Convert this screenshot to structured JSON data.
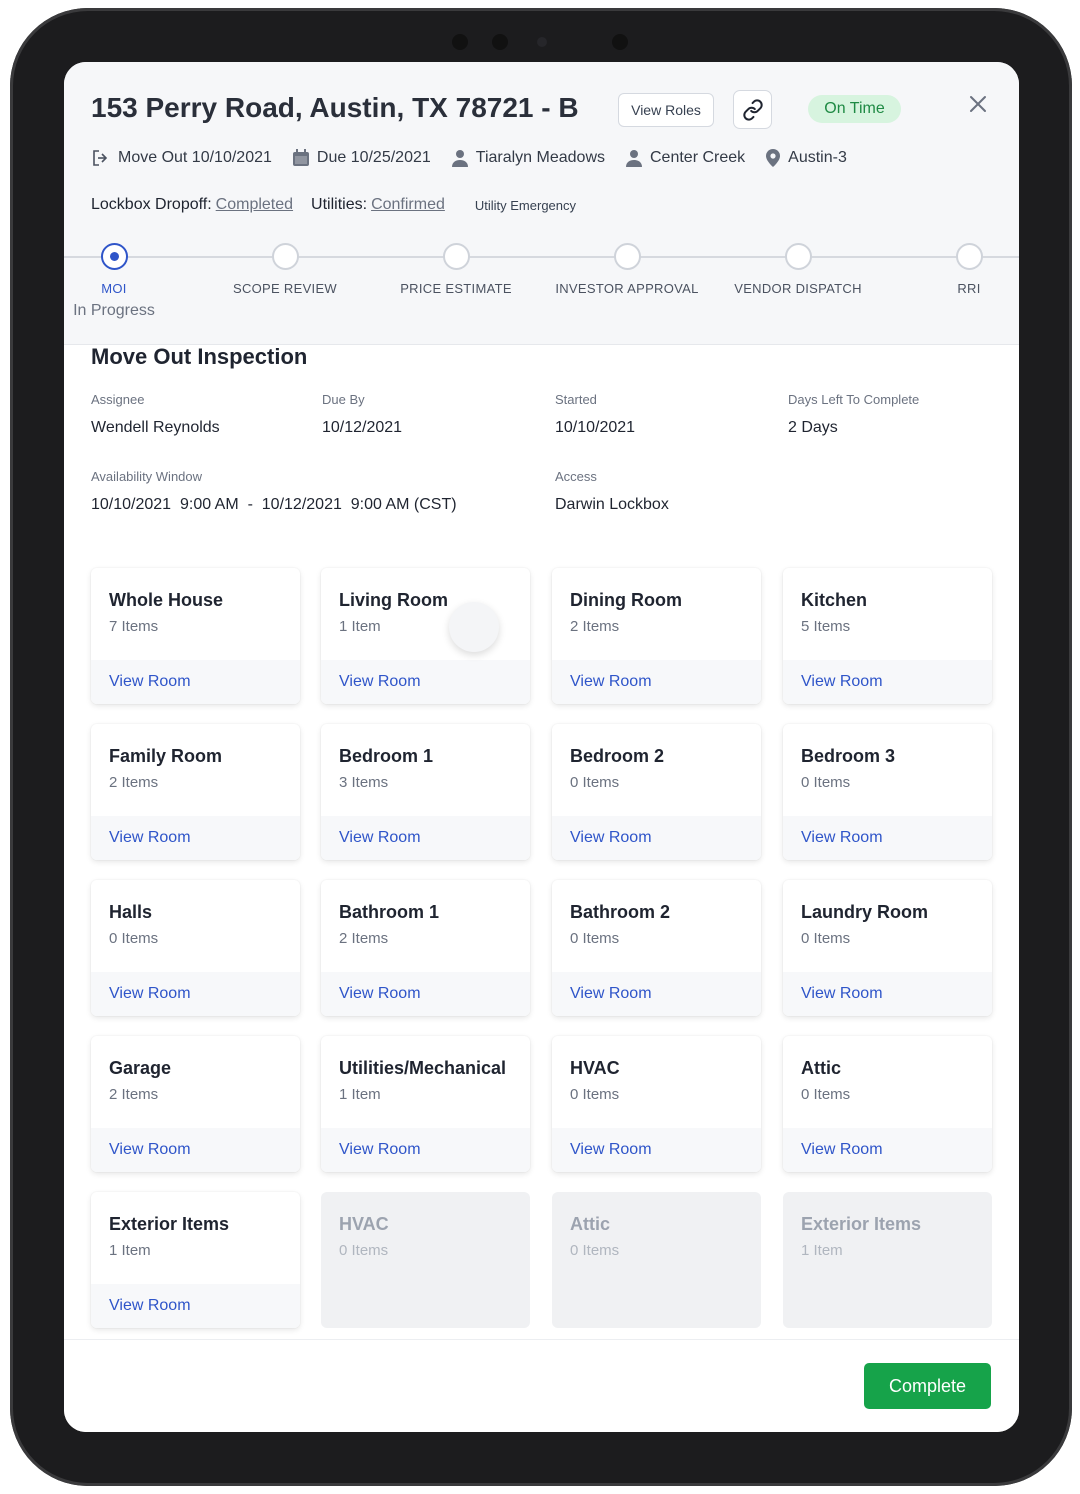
{
  "header": {
    "title": "153 Perry Road, Austin, TX 78721 - B",
    "view_roles_label": "View Roles",
    "status_badge": "On Time",
    "status_color": "#1f8a44"
  },
  "meta": {
    "move_out": "Move Out 10/10/2021",
    "due": "Due 10/25/2021",
    "person": "Tiaralyn Meadows",
    "community": "Center Creek",
    "market": "Austin-3"
  },
  "status_row": {
    "lockbox_label": "Lockbox Dropoff:",
    "lockbox_value": "Completed",
    "utilities_label": "Utilities:",
    "utilities_value": "Confirmed",
    "utility_emergency": "Utility Emergency"
  },
  "stepper": {
    "steps": [
      {
        "label": "MOI",
        "sub": "In Progress",
        "active": true
      },
      {
        "label": "SCOPE REVIEW"
      },
      {
        "label": "PRICE ESTIMATE"
      },
      {
        "label": "INVESTOR APPROVAL"
      },
      {
        "label": "VENDOR DISPATCH"
      },
      {
        "label": "RRI"
      }
    ]
  },
  "inspection": {
    "title": "Move Out Inspection",
    "assignee_label": "Assignee",
    "assignee": "Wendell Reynolds",
    "due_by_label": "Due By",
    "due_by": "10/12/2021",
    "started_label": "Started",
    "started": "10/10/2021",
    "days_left_label": "Days Left To Complete",
    "days_left": "2 Days",
    "availability_label": "Availability Window",
    "availability": "10/10/2021  9:00 AM  -  10/12/2021  9:00 AM (CST)",
    "access_label": "Access",
    "access": "Darwin Lockbox"
  },
  "rooms": [
    {
      "name": "Whole House",
      "count": "7 Items",
      "action": "View Room"
    },
    {
      "name": "Living Room",
      "count": "1 Item",
      "action": "View Room"
    },
    {
      "name": "Dining Room",
      "count": "2 Items",
      "action": "View Room"
    },
    {
      "name": "Kitchen",
      "count": "5 Items",
      "action": "View Room"
    },
    {
      "name": "Family Room",
      "count": "2 Items",
      "action": "View Room"
    },
    {
      "name": "Bedroom 1",
      "count": "3 Items",
      "action": "View Room"
    },
    {
      "name": "Bedroom 2",
      "count": "0 Items",
      "action": "View Room"
    },
    {
      "name": "Bedroom 3",
      "count": "0 Items",
      "action": "View Room"
    },
    {
      "name": "Halls",
      "count": "0 Items",
      "action": "View Room"
    },
    {
      "name": "Bathroom 1",
      "count": "2 Items",
      "action": "View Room"
    },
    {
      "name": "Bathroom 2",
      "count": "0 Items",
      "action": "View Room"
    },
    {
      "name": "Laundry Room",
      "count": "0 Items",
      "action": "View Room"
    },
    {
      "name": "Garage",
      "count": "2 Items",
      "action": "View Room"
    },
    {
      "name": "Utilities/Mechanical",
      "count": "1 Item",
      "action": "View Room"
    },
    {
      "name": "HVAC",
      "count": "0 Items",
      "action": "View Room"
    },
    {
      "name": "Attic",
      "count": "0 Items",
      "action": "View Room"
    },
    {
      "name": "Exterior Items",
      "count": "1 Item",
      "action": "View Room"
    },
    {
      "name": "HVAC",
      "count": "0 Items",
      "disabled": true
    },
    {
      "name": "Attic",
      "count": "0 Items",
      "disabled": true
    },
    {
      "name": "Exterior Items",
      "count": "1 Item",
      "disabled": true
    }
  ],
  "footer": {
    "complete_label": "Complete",
    "complete_color": "#16a34a"
  }
}
